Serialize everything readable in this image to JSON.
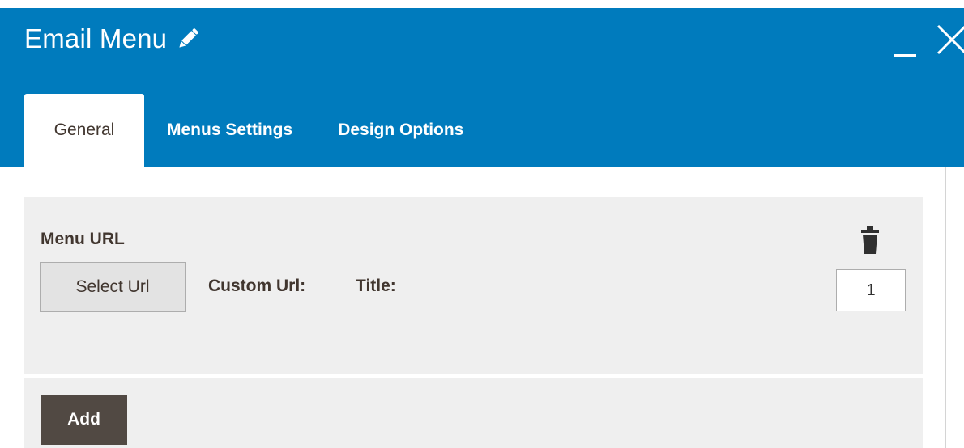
{
  "modal": {
    "title": "Email Menu",
    "edit_icon": "pencil-icon",
    "minimize_icon": "minimize-icon",
    "close_icon": "close-icon"
  },
  "tabs": [
    {
      "label": "General",
      "active": true
    },
    {
      "label": "Menus Settings",
      "active": false
    },
    {
      "label": "Design Options",
      "active": false
    }
  ],
  "menu_item": {
    "section_label": "Menu URL",
    "select_url_label": "Select Url",
    "custom_url_label": "Custom Url:",
    "title_label": "Title:",
    "delete_icon": "trash-icon",
    "order_value": "1"
  },
  "add_button_label": "Add",
  "colors": {
    "header": "#007bbd",
    "panel": "#efefef",
    "button_dark": "#514943",
    "text": "#41362f"
  }
}
